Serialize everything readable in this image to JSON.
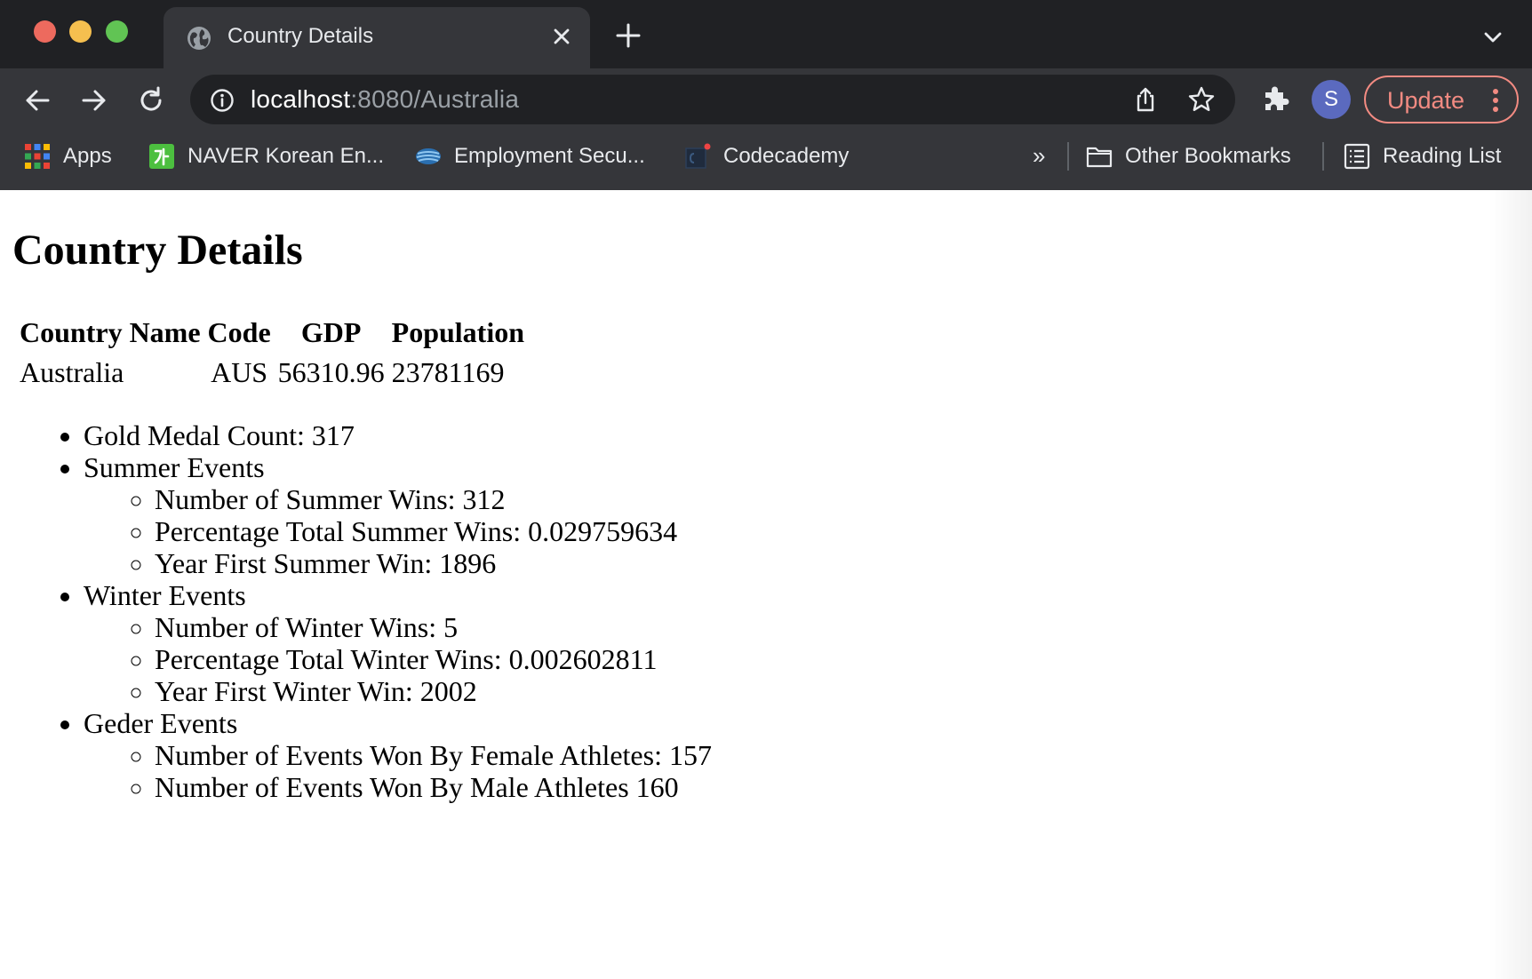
{
  "browser": {
    "tab": {
      "title": "Country Details"
    },
    "address": {
      "host": "localhost",
      "rest": ":8080/Australia"
    },
    "profile_initial": "S",
    "update_label": "Update",
    "bookmarks": {
      "items": [
        {
          "label": "Apps",
          "icon": "apps-grid-icon"
        },
        {
          "label": "NAVER Korean En...",
          "icon": "naver-icon"
        },
        {
          "label": "Employment Secu...",
          "icon": "employment-icon"
        },
        {
          "label": "Codecademy",
          "icon": "codecademy-icon"
        }
      ],
      "overflow": "»",
      "other": "Other Bookmarks",
      "reading_list": "Reading List"
    }
  },
  "page": {
    "heading": "Country Details",
    "table": {
      "headers": [
        "Country Name",
        "Code",
        "GDP",
        "Population"
      ],
      "row": {
        "name": "Australia",
        "code": "AUS",
        "gdp": "56310.96",
        "population": "23781169"
      }
    },
    "list": {
      "gold": "Gold Medal Count: 317",
      "summer": {
        "label": "Summer Events",
        "items": [
          "Number of Summer Wins: 312",
          "Percentage Total Summer Wins: 0.029759634",
          "Year First Summer Win: 1896"
        ]
      },
      "winter": {
        "label": "Winter Events",
        "items": [
          "Number of Winter Wins: 5",
          "Percentage Total Winter Wins: 0.002602811",
          "Year First Winter Win: 2002"
        ]
      },
      "gender": {
        "label": "Geder Events",
        "items": [
          "Number of Events Won By Female Athletes: 157",
          "Number of Events Won By Male Athletes 160"
        ]
      }
    }
  }
}
